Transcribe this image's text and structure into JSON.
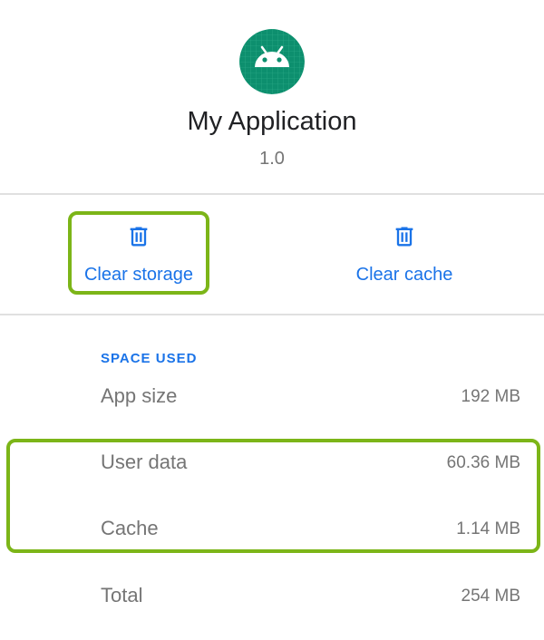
{
  "app": {
    "name": "My Application",
    "version": "1.0",
    "icon": "android-robot-icon",
    "icon_color": "#0d8f6e"
  },
  "actions": {
    "clear_storage": {
      "label": "Clear storage",
      "icon": "trash-icon"
    },
    "clear_cache": {
      "label": "Clear cache",
      "icon": "trash-icon"
    }
  },
  "space_used": {
    "header": "SPACE USED",
    "rows": [
      {
        "label": "App size",
        "value": "192 MB"
      },
      {
        "label": "User data",
        "value": "60.36 MB"
      },
      {
        "label": "Cache",
        "value": "1.14 MB"
      },
      {
        "label": "Total",
        "value": "254 MB"
      }
    ]
  },
  "colors": {
    "accent": "#1a73e8",
    "highlight": "#7cb518",
    "secondary_text": "#757575"
  }
}
